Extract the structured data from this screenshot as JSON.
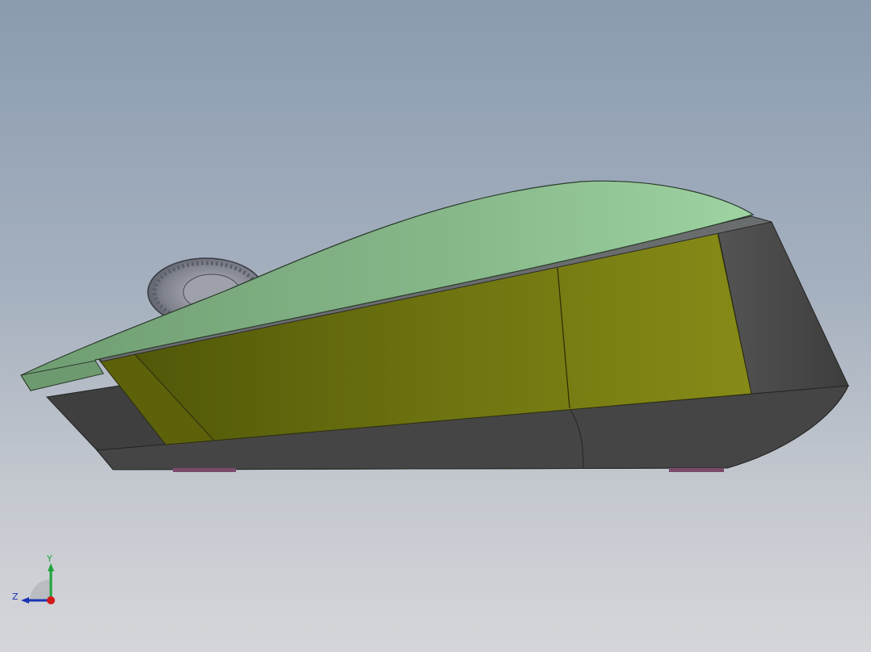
{
  "viewport": {
    "background_top": "#8a9bb0",
    "background_bottom": "#d5d6da"
  },
  "model": {
    "shell_color": "#8dbe8d",
    "side_panel_color": "#6e7212",
    "base_color": "#404040",
    "rear_color": "#4e4e4e",
    "wheel_color": "#8a8c95",
    "foot_color": "#7a4a6a"
  },
  "triad": {
    "y_label": "Y",
    "z_label": "Z",
    "y_color": "#1fa33a",
    "z_color": "#1c33b5",
    "x_color": "#d11a1a"
  }
}
